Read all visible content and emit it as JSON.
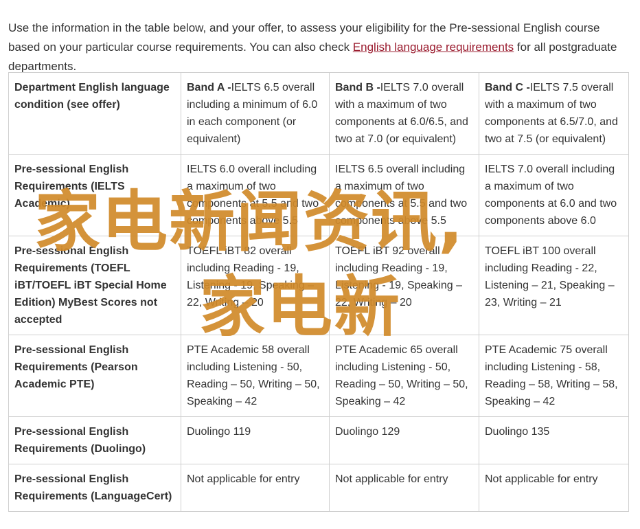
{
  "intro": {
    "text_before": "Use the information in the table below, and your offer, to assess your eligibility for the Pre-sessional English course based on your particular course requirements. You can also check ",
    "link": "English language requirements",
    "text_after": " for all postgraduate departments."
  },
  "table": {
    "rows": [
      {
        "head": "Department English language condition (see offer)",
        "cells": [
          {
            "band": "Band A -",
            "text": "IELTS 6.5 overall including a minimum of 6.0 in each component (or equivalent)"
          },
          {
            "band": "Band B -",
            "text": "IELTS 7.0 overall with a maximum of two components at 6.0/6.5, and two at 7.0 (or equivalent)"
          },
          {
            "band": "Band C -",
            "text": "IELTS 7.5 overall with a maximum of two components at 6.5/7.0, and two at 7.5 (or equivalent)"
          }
        ]
      },
      {
        "head": "Pre-sessional English Requirements (IELTS Academic)",
        "cells": [
          {
            "band": "",
            "text": "IELTS 6.0 overall including a maximum of two components at 5.5 and two components above 5.5"
          },
          {
            "band": "",
            "text": "IELTS 6.5 overall including a maximum of two components at 5.5 and two components above 5.5"
          },
          {
            "band": "",
            "text": "IELTS 7.0 overall including a maximum of two components at 6.0 and two components above 6.0"
          }
        ]
      },
      {
        "head": "Pre-sessional English Requirements (TOEFL iBT/TOEFL iBT Special Home Edition) MyBest Scores not accepted",
        "cells": [
          {
            "band": "",
            "text": "TOEFL iBT 82 overall including Reading - 19, Listening - 19, Speaking – 22, Writing – 20"
          },
          {
            "band": "",
            "text": "TOEFL iBT 92 overall including Reading - 19, Listening - 19, Speaking – 22, Writing – 20"
          },
          {
            "band": "",
            "text": "TOEFL iBT 100 overall including Reading - 22, Listening – 21, Speaking – 23, Writing – 21"
          }
        ]
      },
      {
        "head": "Pre-sessional English Requirements (Pearson Academic PTE)",
        "cells": [
          {
            "band": "",
            "text": "PTE Academic 58 overall including Listening - 50, Reading – 50, Writing – 50, Speaking – 42"
          },
          {
            "band": "",
            "text": "PTE Academic 65 overall including Listening - 50, Reading – 50, Writing – 50, Speaking – 42"
          },
          {
            "band": "",
            "text": "PTE Academic 75 overall including Listening - 58, Reading – 58, Writing – 58, Speaking – 42"
          }
        ]
      },
      {
        "head": "Pre-sessional English Requirements (Duolingo)",
        "cells": [
          {
            "band": "",
            "text": "Duolingo 119"
          },
          {
            "band": "",
            "text": "Duolingo 129"
          },
          {
            "band": "",
            "text": "Duolingo 135"
          }
        ]
      },
      {
        "head": "Pre-sessional English Requirements (LanguageCert)",
        "cells": [
          {
            "band": "",
            "text": "Not applicable for entry"
          },
          {
            "band": "",
            "text": "Not applicable for entry"
          },
          {
            "band": "",
            "text": "Not applicable for entry"
          }
        ]
      }
    ]
  },
  "watermark": {
    "line1": "家电新闻资讯,",
    "line2": "家电新",
    "color": "#d18a2a"
  },
  "colors": {
    "link": "#9a1b2e",
    "border": "#cfcfcf",
    "text": "#333333"
  }
}
